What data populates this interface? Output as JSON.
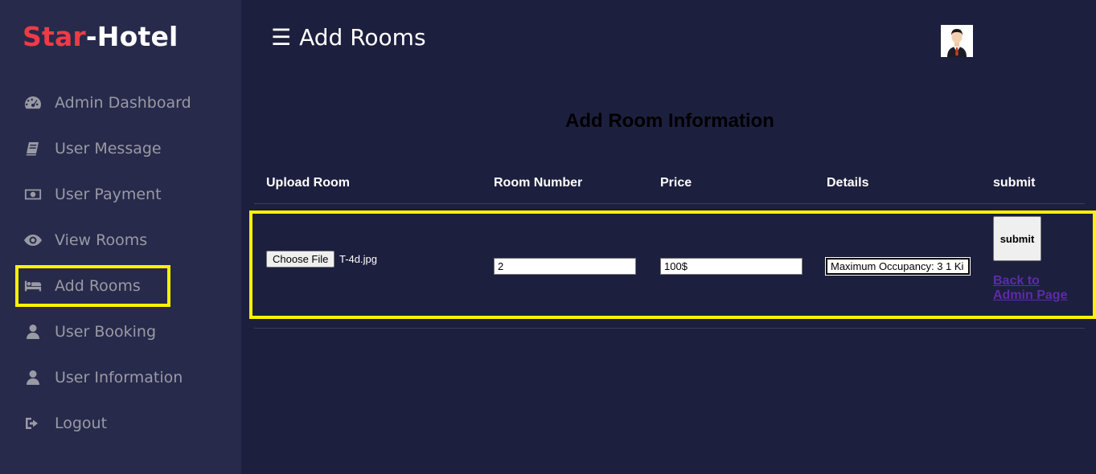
{
  "brand": {
    "part1": "Star",
    "part2": "-Hotel"
  },
  "sidebar": {
    "items": [
      {
        "label": "Admin Dashboard",
        "icon": "dashboard-icon"
      },
      {
        "label": "User Message",
        "icon": "book-icon"
      },
      {
        "label": "User Payment",
        "icon": "money-icon"
      },
      {
        "label": "View Rooms",
        "icon": "eye-icon"
      },
      {
        "label": "Add Rooms",
        "icon": "bed-icon",
        "highlighted": true
      },
      {
        "label": "User Booking",
        "icon": "user-icon"
      },
      {
        "label": "User Information",
        "icon": "user-icon"
      },
      {
        "label": "Logout",
        "icon": "sign-out-icon"
      }
    ]
  },
  "header": {
    "menu_glyph": "☰",
    "title": "Add Rooms"
  },
  "main": {
    "section_title": "Add Room Information",
    "columns": [
      "Upload Room",
      "Room Number",
      "Price",
      "Details",
      "submit"
    ],
    "row": {
      "file_button_label": "Choose File",
      "file_name": "T-4d.jpg",
      "room_number": "2",
      "price": "100$",
      "details": "Maximum Occupancy: 3 1 Ki",
      "submit_label": "submit",
      "back_link": "Back to Admin Page"
    }
  },
  "colors": {
    "sidebar_bg": "#272a4b",
    "main_bg": "#1d1f3e",
    "brand_red": "#ee3b47",
    "highlight": "#fff200",
    "link": "#5e2ba8"
  }
}
